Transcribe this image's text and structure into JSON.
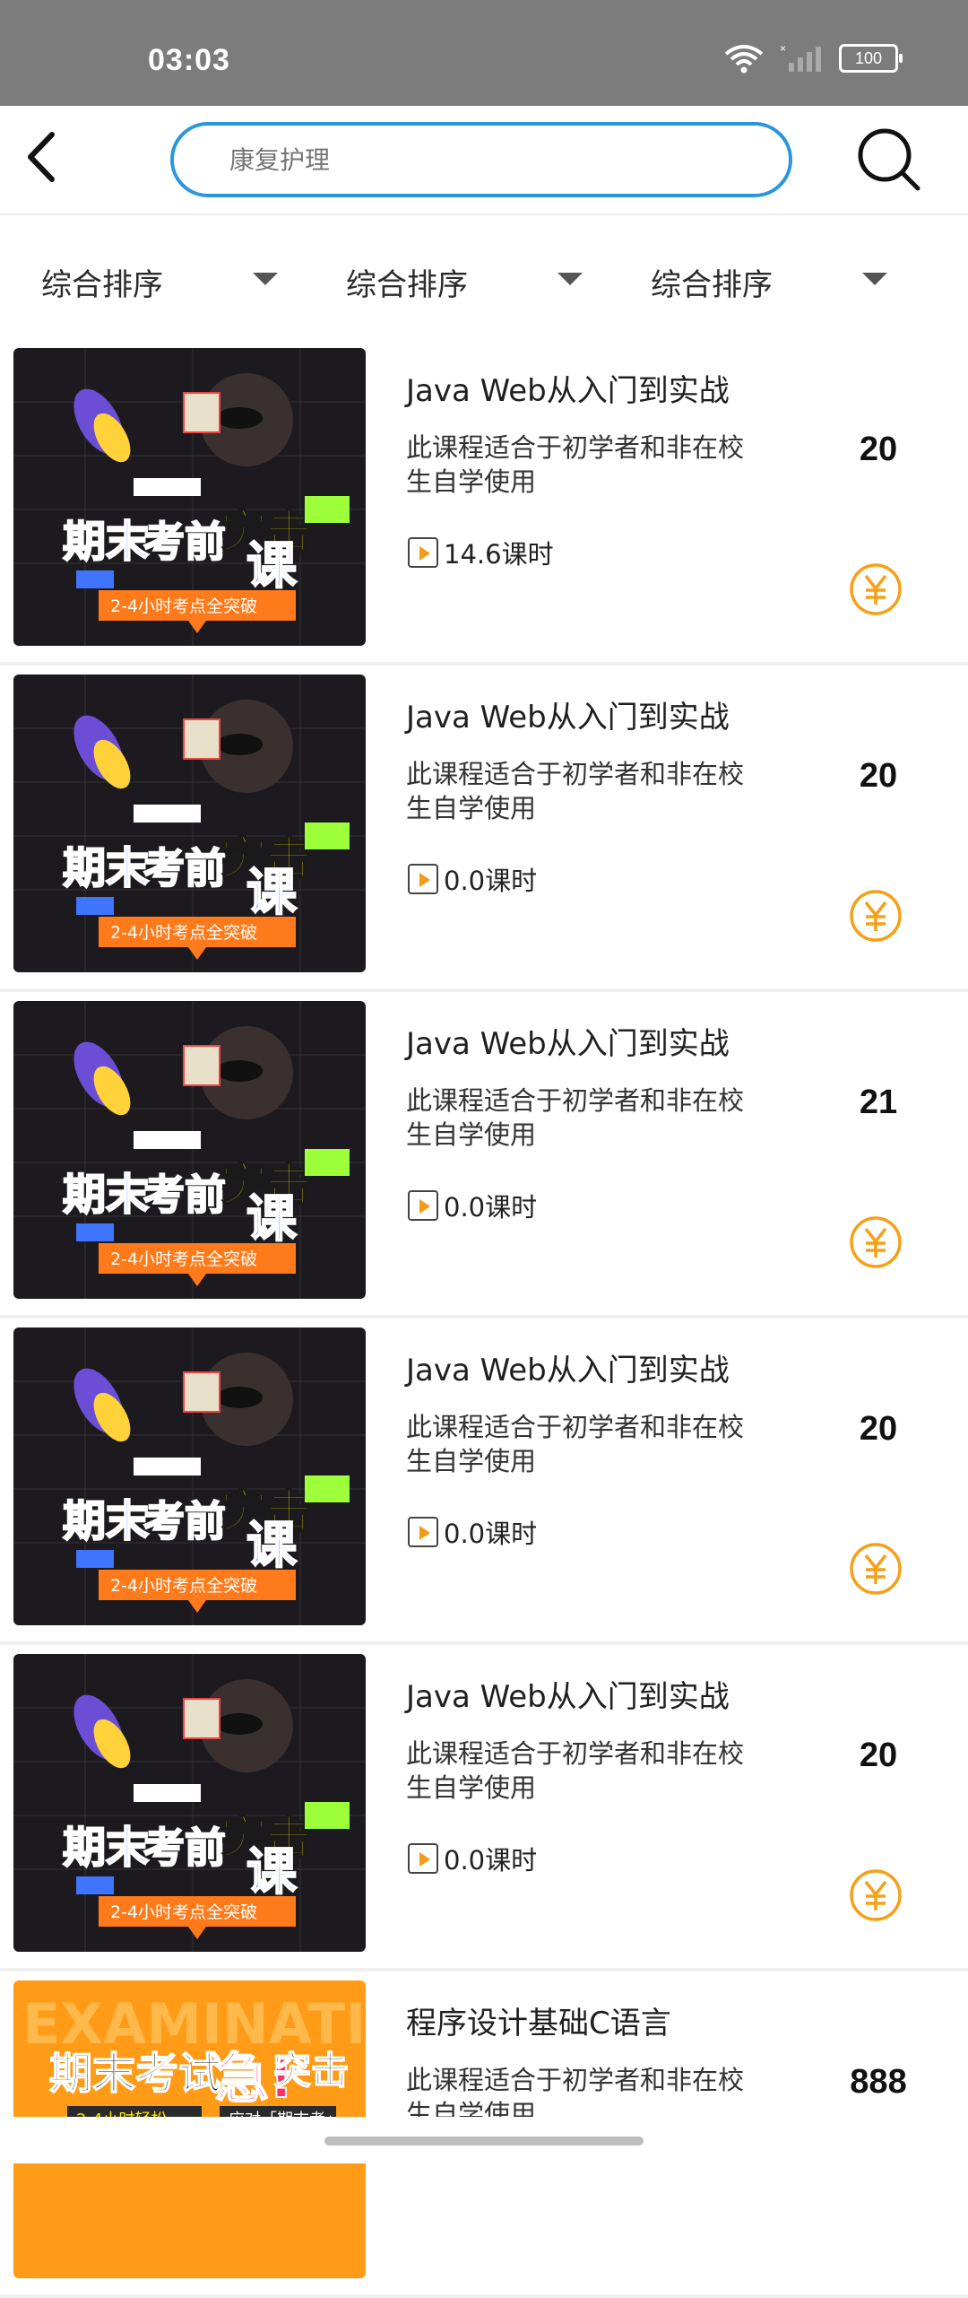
{
  "status_bar": {
    "time": "03:03",
    "battery": "100"
  },
  "search": {
    "placeholder": "康复护理"
  },
  "sort_bar": {
    "items": [
      "综合排序",
      "综合排序",
      "综合排序"
    ]
  },
  "courses": [
    {
      "title": "Java Web从入门到实战",
      "description": "此课程适合于初学者和非在校生自学使用",
      "hours": "14.6课时",
      "price": "20",
      "thumbnail": "期末考前突击课"
    },
    {
      "title": "Java Web从入门到实战",
      "description": "此课程适合于初学者和非在校生自学使用",
      "hours": "0.0课时",
      "price": "20",
      "thumbnail": "期末考前突击课"
    },
    {
      "title": "Java Web从入门到实战",
      "description": "此课程适合于初学者和非在校生自学使用",
      "hours": "0.0课时",
      "price": "21",
      "thumbnail": "期末考前突击课"
    },
    {
      "title": "Java Web从入门到实战",
      "description": "此课程适合于初学者和非在校生自学使用",
      "hours": "0.0课时",
      "price": "20",
      "thumbnail": "期末考前突击课"
    },
    {
      "title": "Java Web从入门到实战",
      "description": "此课程适合于初学者和非在校生自学使用",
      "hours": "0.0课时",
      "price": "20",
      "thumbnail": "期末考前突击课"
    },
    {
      "title": "程序设计基础C语言",
      "description": "此课程适合于初学者和非在校生自学使用",
      "hours": "",
      "price": "888",
      "thumbnail": "期末考试急!突击"
    }
  ],
  "colors": {
    "status_bar_bg": "#7c7c7c",
    "accent_blue": "#2b96db",
    "price_icon_orange": "#f5a018"
  }
}
